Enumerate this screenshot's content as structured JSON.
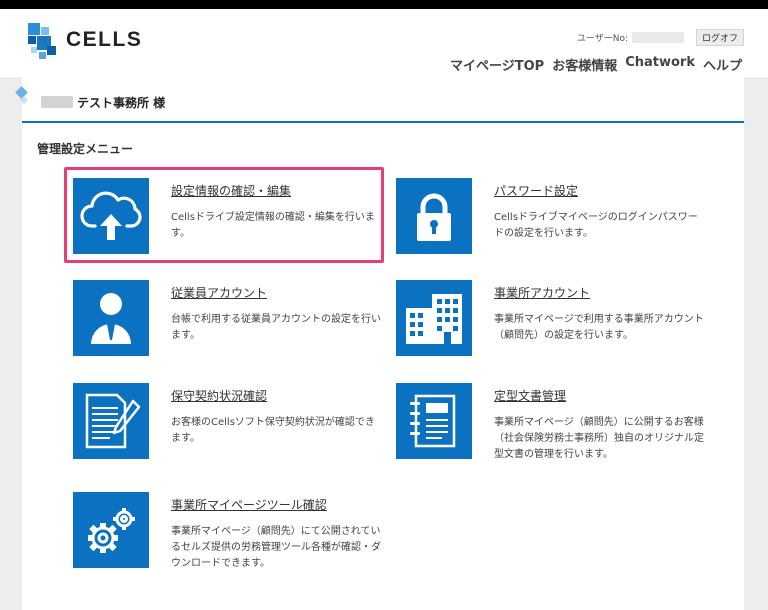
{
  "header": {
    "logo_text": "CELLS",
    "user_no_label": "ユーザーNo:",
    "logoff_label": "ログオフ",
    "nav": [
      "マイページTOP",
      "お客様情報",
      "Chatwork",
      "ヘルプ"
    ]
  },
  "office": {
    "name": "テスト事務所 様"
  },
  "menu": {
    "title": "管理設定メニュー",
    "items": [
      {
        "title": "設定情報の確認・編集",
        "desc": "Cellsドライブ設定情報の確認・編集を行います。",
        "icon": "cloud-upload-icon"
      },
      {
        "title": "パスワード設定",
        "desc": "Cellsドライブマイページのログインパスワードの設定を行います。",
        "icon": "lock-icon"
      },
      {
        "title": "従業員アカウント",
        "desc": "台帳で利用する従業員アカウントの設定を行います。",
        "icon": "employee-icon"
      },
      {
        "title": "事業所アカウント",
        "desc": "事業所マイページで利用する事業所アカウント（顧問先）の設定を行います。",
        "icon": "building-icon"
      },
      {
        "title": "保守契約状況確認",
        "desc": "お客様のCellsソフト保守契約状況が確認できます。",
        "icon": "document-edit-icon"
      },
      {
        "title": "定型文書管理",
        "desc": "事業所マイページ（顧問先）に公開するお客様（社会保険労務士事務所）独自のオリジナル定型文書の管理を行います。",
        "icon": "document-binder-icon"
      },
      {
        "title": "事業所マイページツール確認",
        "desc": "事業所マイページ（顧問先）にて公開されているセルズ提供の労務管理ツール各種が確認・ダウンロードできます。",
        "icon": "gears-icon"
      }
    ]
  },
  "colors": {
    "accent": "#0b72c2",
    "highlight": "#e83e78",
    "background": "#ededed"
  }
}
